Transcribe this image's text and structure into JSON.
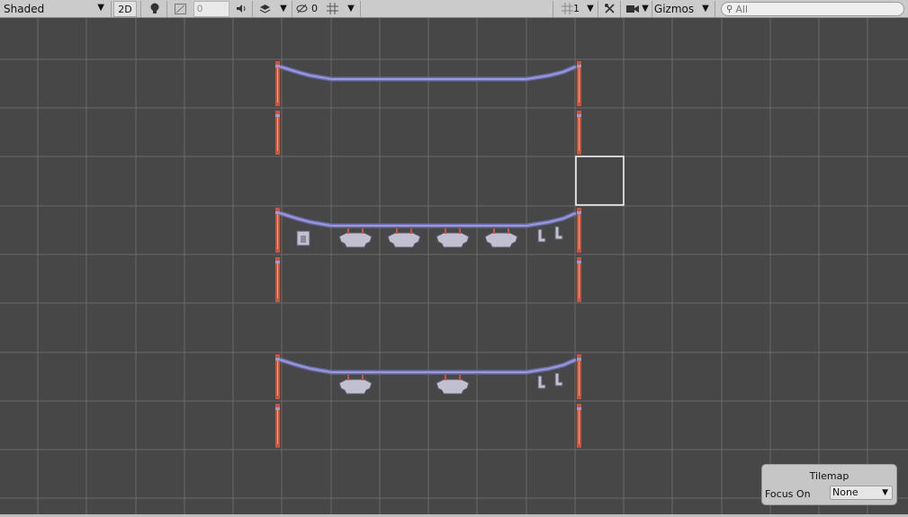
{
  "toolbar": {
    "shading_mode": "Shaded",
    "mode_2d": "2D",
    "fx_value": "0",
    "hidden_count": "0",
    "grid_snap_value": "1",
    "gizmos_label": "Gizmos",
    "search_placeholder": "All"
  },
  "icons": {
    "shading_dropdown": "triangle-down",
    "lighting": "bulb-icon",
    "effects": "image-icon",
    "audio": "speaker-icon",
    "layers": "layers-icon",
    "visibility": "eye-slash-icon",
    "grid": "grid-icon",
    "tools": "wrench-icon",
    "camera": "camera-icon",
    "search": "magnifier-icon"
  },
  "tilemap_overlay": {
    "title": "Tilemap",
    "focus_label": "Focus On",
    "focus_value": "None"
  },
  "colors": {
    "scene_bg": "#474747",
    "grid_line": "#6a6a6a",
    "post": "#c8563f",
    "post_highlight": "#f0a27a",
    "rope": "#9a9ad8",
    "rope_dark": "#6c6cae",
    "cloth": "#c0c0d0",
    "selection": "#ffffff",
    "toolbar_bg": "#cbcbcb"
  }
}
